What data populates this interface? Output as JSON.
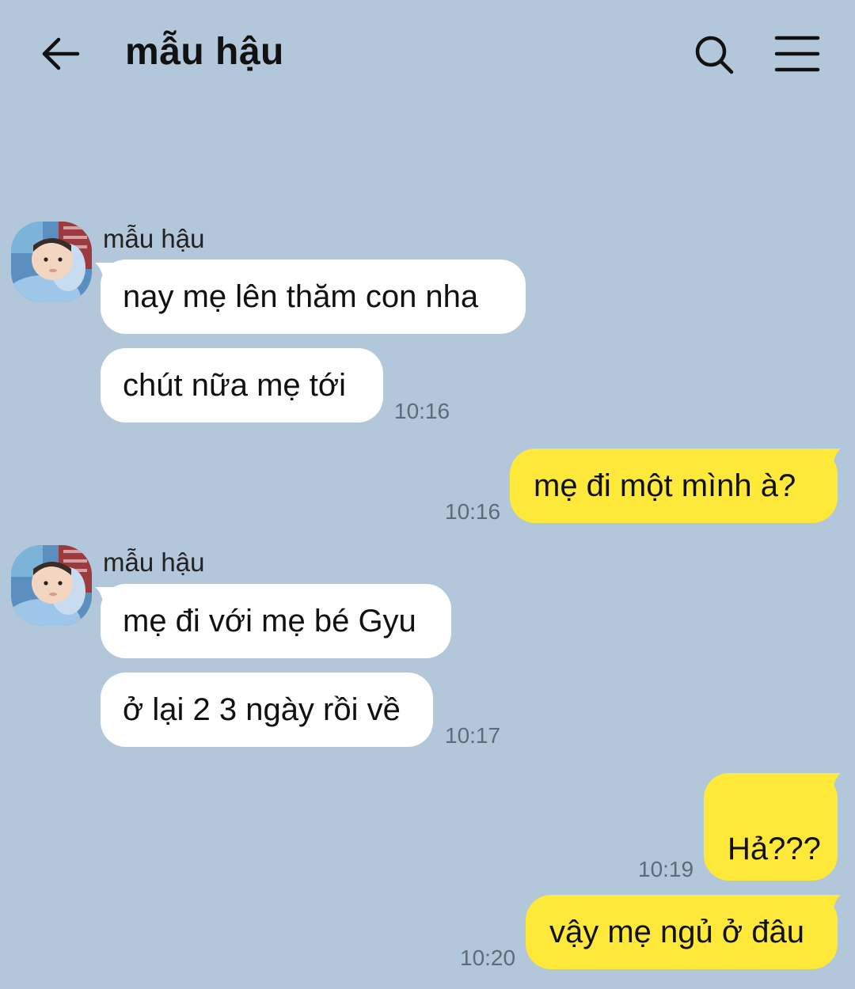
{
  "header": {
    "title": "mẫu hậu",
    "back_icon": "arrow-left-icon",
    "search_icon": "search-icon",
    "menu_icon": "menu-icon"
  },
  "colors": {
    "background": "#b2c7da",
    "incoming_bubble": "#ffffff",
    "outgoing_bubble": "#fee83a",
    "timestamp": "#5e6b78"
  },
  "messages": {
    "g1": {
      "sender": "mẫu hậu",
      "m1": "nay mẹ lên thăm con nha",
      "m2": "chút nữa mẹ tới",
      "time": "10:16"
    },
    "o1": {
      "text": "mẹ đi một mình à?",
      "time": "10:16"
    },
    "g2": {
      "sender": "mẫu hậu",
      "m1": "mẹ đi với mẹ bé Gyu",
      "m2": "ở lại 2 3 ngày rồi về",
      "time": "10:17"
    },
    "o2": {
      "text": "Hả???",
      "time": "10:19"
    },
    "o3": {
      "text": "vậy mẹ ngủ ở đâu",
      "time": "10:20"
    }
  }
}
